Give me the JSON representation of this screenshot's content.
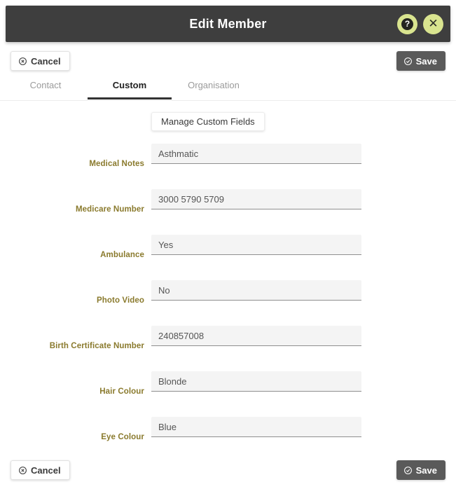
{
  "window": {
    "title": "Edit Member",
    "help_icon": "help-circle-icon",
    "close_icon": "close-icon",
    "accent_color": "#d9e48f",
    "header_bg": "#3e3e3e"
  },
  "actions": {
    "cancel_label": "Cancel",
    "cancel_icon": "circle-x-icon",
    "save_label": "Save",
    "save_icon": "circle-check-icon",
    "save_bg": "#5a5a5a"
  },
  "tabs": [
    {
      "label": "Contact",
      "active": false
    },
    {
      "label": "Custom",
      "active": true
    },
    {
      "label": "Organisation",
      "active": false
    }
  ],
  "toolbar": {
    "manage_custom_fields_label": "Manage Custom Fields"
  },
  "form": {
    "label_color": "#8a7a2d",
    "fields": [
      {
        "label": "Medical Notes",
        "value": "Asthmatic"
      },
      {
        "label": "Medicare Number",
        "value": "3000 5790 5709"
      },
      {
        "label": "Ambulance",
        "value": "Yes"
      },
      {
        "label": "Photo Video",
        "value": "No"
      },
      {
        "label": "Birth Certificate Number",
        "value": "240857008"
      },
      {
        "label": "Hair Colour",
        "value": "Blonde"
      },
      {
        "label": "Eye Colour",
        "value": "Blue"
      }
    ]
  }
}
